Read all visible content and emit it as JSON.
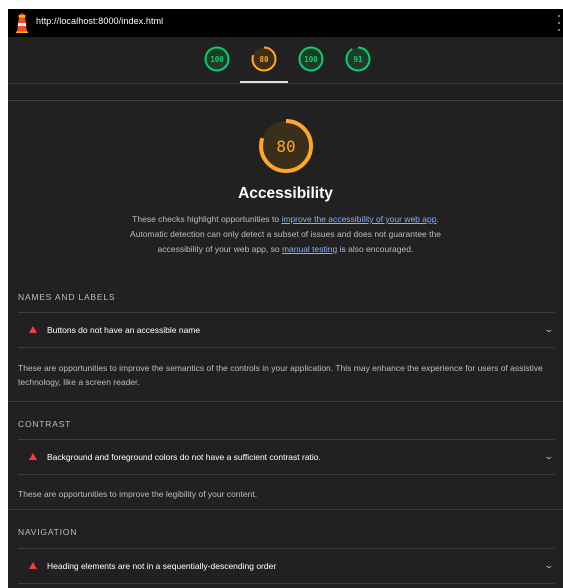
{
  "topbar": {
    "url": "http://localhost:8000/index.html",
    "logo_icon": "lighthouse-icon",
    "menu_icon": "kebab-menu-icon"
  },
  "scores": [
    {
      "value": "100",
      "score": 100,
      "color": "#0cce6b"
    },
    {
      "value": "80",
      "score": 80,
      "color": "#ffa726"
    },
    {
      "value": "100",
      "score": 100,
      "color": "#0cce6b"
    },
    {
      "value": "91",
      "score": 91,
      "color": "#0cce6b"
    }
  ],
  "category": {
    "score_label": "80",
    "score": 80,
    "color": "#ffa726",
    "title": "Accessibility",
    "desc_part1": "These checks highlight opportunities to ",
    "desc_link1": "improve the accessibility of your web app",
    "desc_part2": ". Automatic detection can only detect a subset of issues and does not guarantee the accessibility of your web app, so ",
    "desc_link2": "manual testing",
    "desc_part3": " is also encouraged."
  },
  "groups": [
    {
      "heading": "NAMES AND LABELS",
      "audit": "Buttons do not have an accessible name",
      "description": "These are opportunities to improve the semantics of the controls in your application. This may enhance the experience for users of assistive technology, like a screen reader."
    },
    {
      "heading": "CONTRAST",
      "audit": "Background and foreground colors do not have a sufficient contrast ratio.",
      "description": "These are opportunities to improve the legibility of your content."
    },
    {
      "heading": "NAVIGATION",
      "audit": "Heading elements are not in a sequentially-descending order"
    }
  ],
  "colors": {
    "fail": "#ff3b30",
    "pass": "#0cce6b",
    "average": "#ffa726",
    "link": "#7fb2ff"
  }
}
